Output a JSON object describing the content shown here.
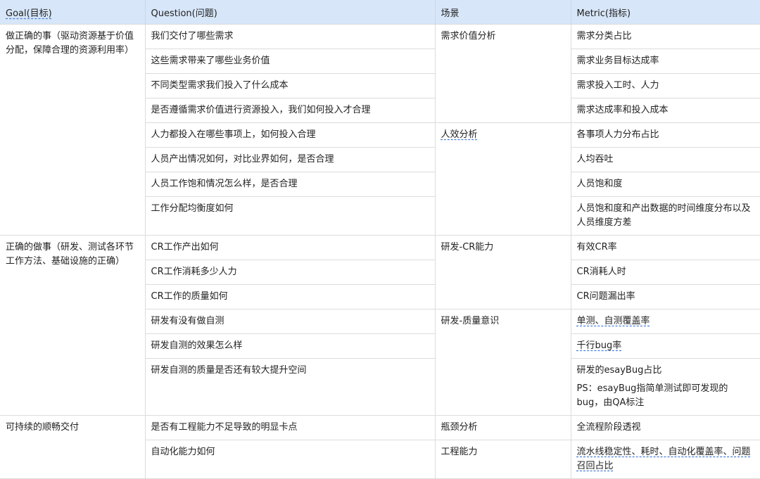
{
  "headers": [
    "Goal(目标)",
    "Question(问题)",
    "场景",
    "Metric(指标)"
  ],
  "goals": [
    "做正确的事（驱动资源基于价值分配，保障合理的资源利用率）",
    "正确的做事（研发、测试各环节工作方法、基础设施的正确）",
    "可持续的顺畅交付"
  ],
  "scenes": [
    "需求价值分析",
    "人效分析",
    "研发-CR能力",
    "研发-质量意识",
    "瓶颈分析",
    "工程能力"
  ],
  "rows": [
    {
      "q": "我们交付了哪些需求",
      "m": "需求分类占比"
    },
    {
      "q": "这些需求带来了哪些业务价值",
      "m": "需求业务目标达成率"
    },
    {
      "q": "不同类型需求我们投入了什么成本",
      "m": "需求投入工时、人力"
    },
    {
      "q": "是否遵循需求价值进行资源投入，我们如何投入才合理",
      "m": "需求达成率和投入成本"
    },
    {
      "q": "人力都投入在哪些事项上，如何投入合理",
      "m": "各事项人力分布占比"
    },
    {
      "q": "人员产出情况如何，对比业界如何，是否合理",
      "m": "人均吞吐"
    },
    {
      "q": "人员工作饱和情况怎么样，是否合理",
      "m": "人员饱和度"
    },
    {
      "q": "工作分配均衡度如何",
      "m": "人员饱和度和产出数据的时间维度分布以及人员维度方差"
    },
    {
      "q": "CR工作产出如何",
      "m": "有效CR率"
    },
    {
      "q": "CR工作消耗多少人力",
      "m": "CR消耗人时"
    },
    {
      "q": "CR工作的质量如何",
      "m": "CR问题漏出率"
    },
    {
      "q": "研发有没有做自测",
      "m": "单测、自测覆盖率"
    },
    {
      "q": "研发自测的效果怎么样",
      "m": "千行bug率"
    },
    {
      "q": "研发自测的质量是否还有较大提升空间",
      "m": "研发的esayBug占比",
      "note": "PS：esayBug指简单测试即可发现的bug，由QA标注"
    },
    {
      "q": "是否有工程能力不足导致的明显卡点",
      "m": "全流程阶段透视"
    },
    {
      "q": "自动化能力如何",
      "m": "流水线稳定性、耗时、自动化覆盖率、问题召回占比"
    }
  ]
}
